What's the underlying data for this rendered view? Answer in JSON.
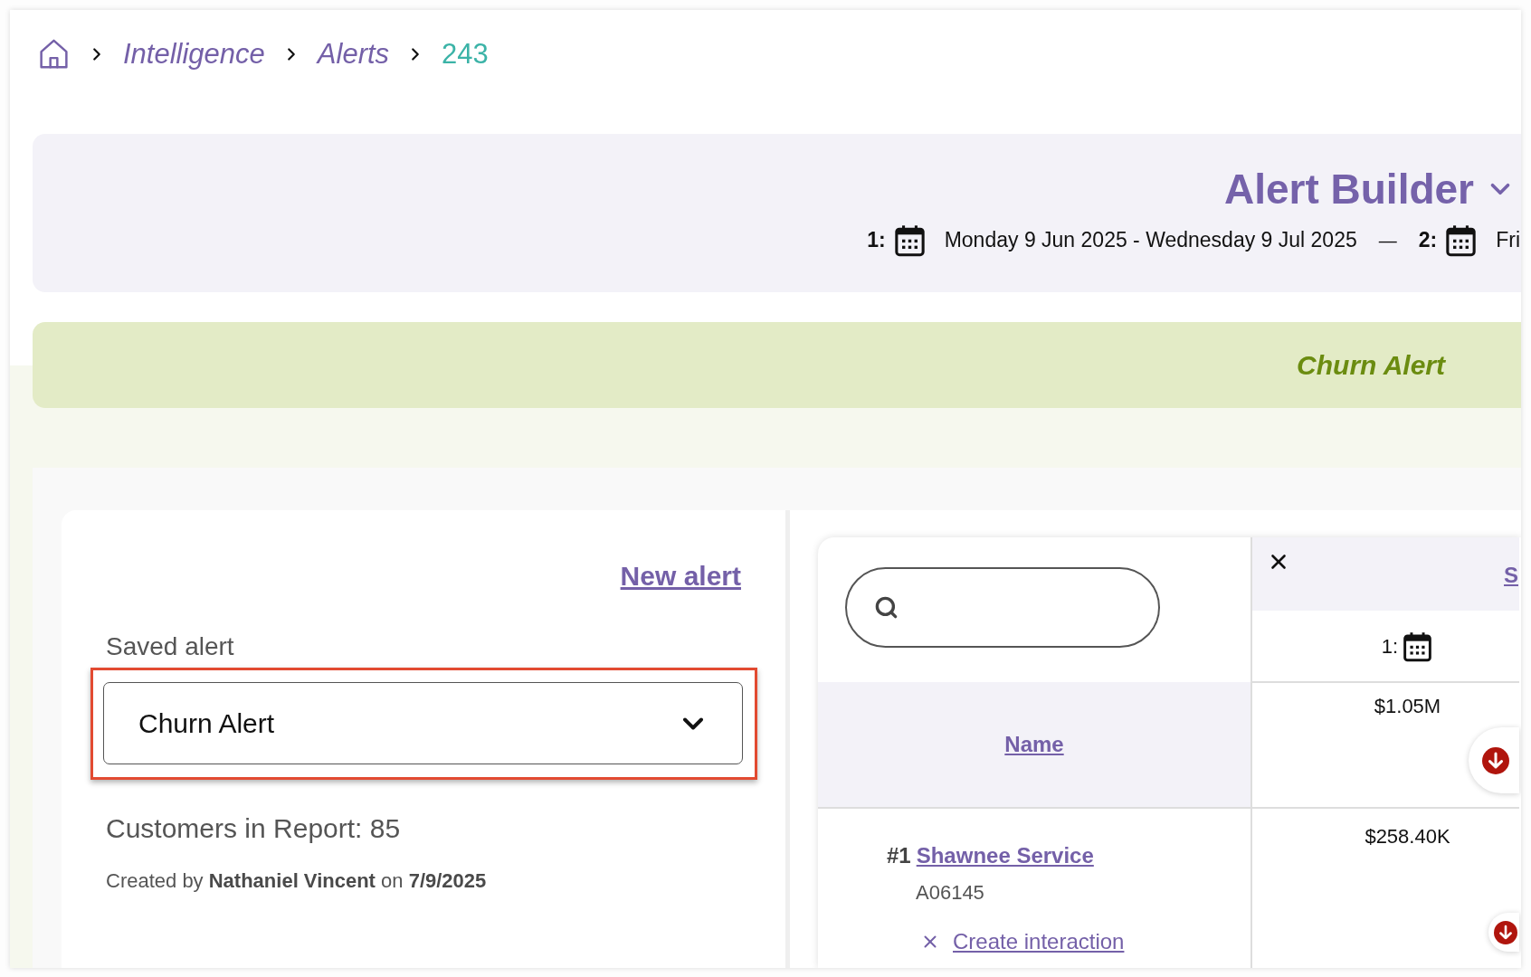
{
  "breadcrumb": [
    {
      "label": "Intelligence",
      "kind": "link"
    },
    {
      "label": "Alerts",
      "kind": "link"
    },
    {
      "label": "243",
      "kind": "current"
    }
  ],
  "header": {
    "title": "Alert Builder",
    "periods": [
      {
        "label": "1:",
        "range": "Monday 9 Jun 2025 - Wednesday 9 Jul 2025"
      },
      {
        "label": "2:",
        "range": "Fri"
      }
    ],
    "separator": "—"
  },
  "banner": {
    "title": "Churn Alert"
  },
  "alert_panel": {
    "new_alert": "New alert",
    "saved_alert": {
      "label": "Saved alert",
      "value": "Churn Alert",
      "highlighted": true
    },
    "customers": "Customers in Report: 85",
    "created": "Created by **Nathaniel Vincent** on **7/9/2025**"
  },
  "table": {
    "column_2_link": "S",
    "name_header": "Name",
    "period_label": "1:",
    "total": {
      "value": "$1.05M",
      "declining": true
    },
    "rows": [
      {
        "rank": "#1",
        "name": "Shawnee Service",
        "code": "A06145",
        "action": "Create interaction",
        "value": "$258.40K",
        "declining": true
      }
    ]
  }
}
